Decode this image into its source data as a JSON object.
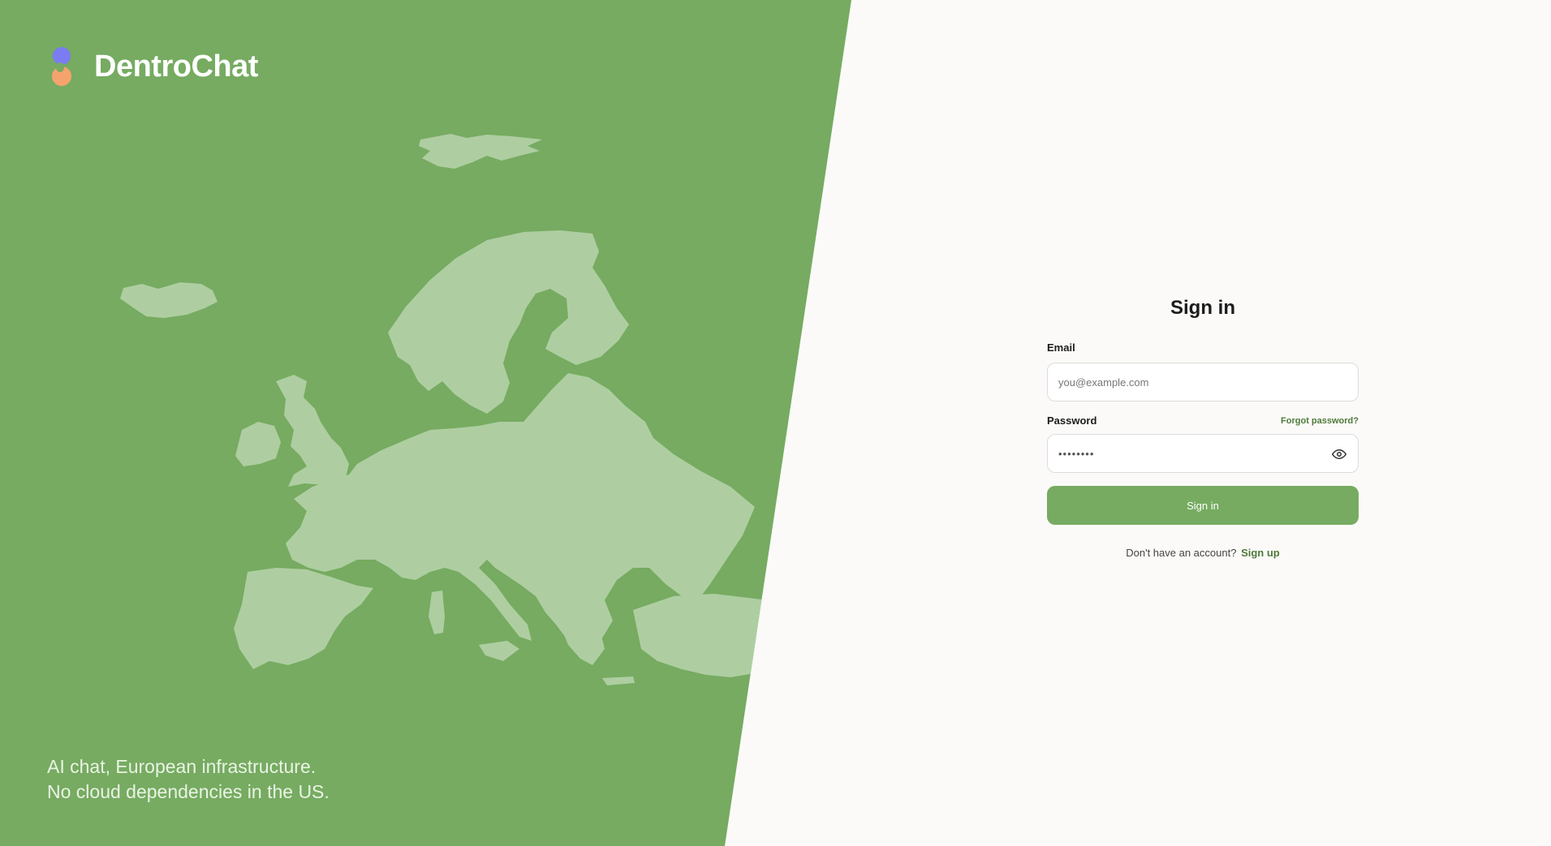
{
  "brand": {
    "name": "DentroChat",
    "logo_icon": "two-dots-logo-icon",
    "colors": {
      "panel": "#76ab61",
      "map": "#aecea1",
      "dot_top": "#7b7cf2",
      "dot_bottom": "#f5a36d"
    }
  },
  "hero": {
    "tagline_line1": "AI chat, European infrastructure.",
    "tagline_line2": "No cloud dependencies in the US."
  },
  "signin": {
    "title": "Sign in",
    "email_label": "Email",
    "email_placeholder": "you@example.com",
    "password_label": "Password",
    "forgot_label": "Forgot password?",
    "password_value": "••••••••",
    "show_password_icon": "eye-icon",
    "submit_label": "Sign in",
    "no_account_text": "Don't have an account?",
    "signup_label": "Sign up",
    "accent_color": "#4e7a3b"
  }
}
